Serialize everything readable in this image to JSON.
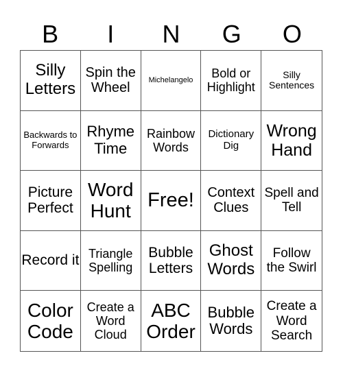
{
  "header": [
    "B",
    "I",
    "N",
    "G",
    "O"
  ],
  "cells": [
    {
      "text": "Silly Letters",
      "size": 24
    },
    {
      "text": "Spin the Wheel",
      "size": 20
    },
    {
      "text": "Michelangelo",
      "size": 11
    },
    {
      "text": "Bold or Highlight",
      "size": 18
    },
    {
      "text": "Silly Sentences",
      "size": 14
    },
    {
      "text": "Backwards to Forwards",
      "size": 13
    },
    {
      "text": "Rhyme Time",
      "size": 22
    },
    {
      "text": "Rainbow Words",
      "size": 18
    },
    {
      "text": "Dictionary Dig",
      "size": 15
    },
    {
      "text": "Wrong Hand",
      "size": 25
    },
    {
      "text": "Picture Perfect",
      "size": 21
    },
    {
      "text": "Word Hunt",
      "size": 28
    },
    {
      "text": "Free!",
      "size": 29
    },
    {
      "text": "Context Clues",
      "size": 20
    },
    {
      "text": "Spell and Tell",
      "size": 19
    },
    {
      "text": "Record it",
      "size": 21
    },
    {
      "text": "Triangle Spelling",
      "size": 18
    },
    {
      "text": "Bubble Letters",
      "size": 21
    },
    {
      "text": "Ghost Words",
      "size": 24
    },
    {
      "text": "Follow the Swirl",
      "size": 19
    },
    {
      "text": "Color Code",
      "size": 28
    },
    {
      "text": "Create a Word Cloud",
      "size": 18
    },
    {
      "text": "ABC Order",
      "size": 28
    },
    {
      "text": "Bubble Words",
      "size": 22
    },
    {
      "text": "Create a Word Search",
      "size": 19
    }
  ]
}
